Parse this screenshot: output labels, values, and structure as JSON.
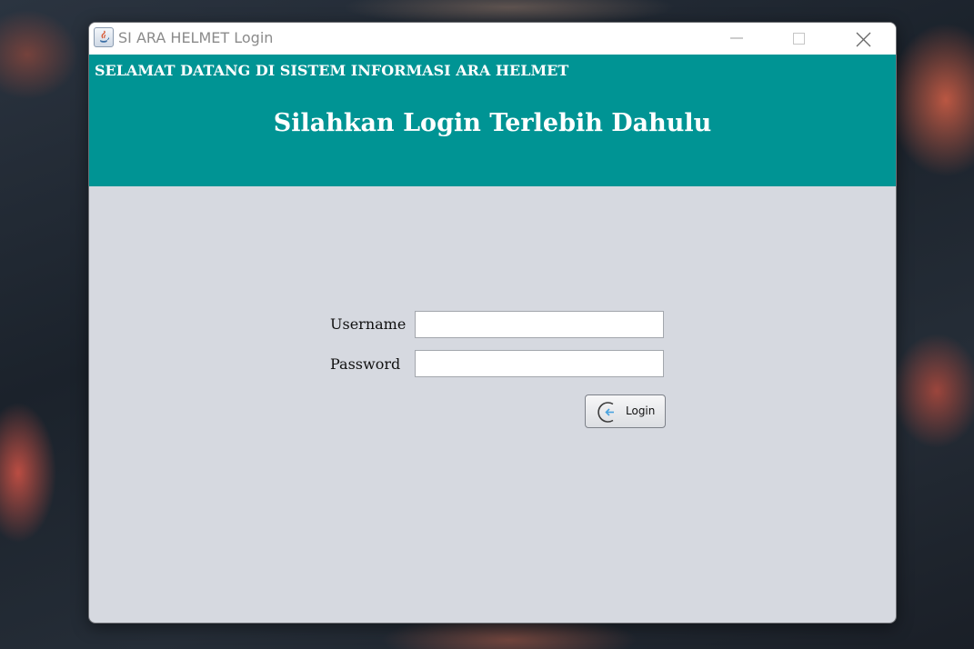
{
  "window": {
    "title": "SI ARA HELMET Login",
    "controls": {
      "minimize_icon": "minimize-icon",
      "maximize_icon": "maximize-icon",
      "close_icon": "close-icon"
    }
  },
  "header": {
    "welcome": "SELAMAT DATANG DI SISTEM INFORMASI ARA HELMET",
    "headline": "Silahkan Login Terlebih Dahulu",
    "background_color": "#009494"
  },
  "form": {
    "username_label": "Username",
    "username_value": "",
    "password_label": "Password",
    "password_value": "",
    "login_button": {
      "label": "Login",
      "icon": "login-arrow-icon"
    }
  },
  "colors": {
    "body_background": "#d6d9e0",
    "accent": "#009494"
  }
}
